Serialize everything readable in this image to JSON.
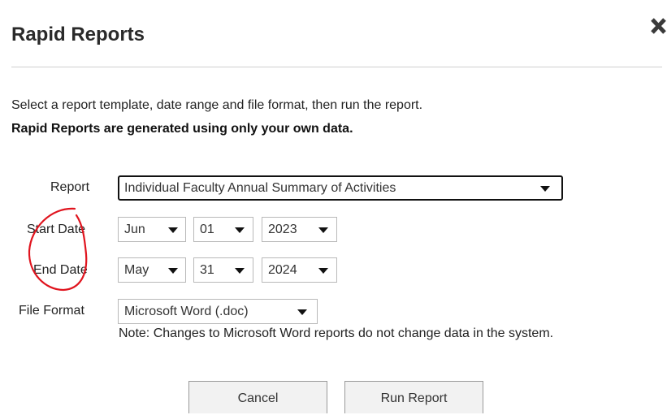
{
  "dialog": {
    "title": "Rapid Reports",
    "close_icon": "close-icon"
  },
  "intro": {
    "text": "Select a report template, date range and file format, then run the report.",
    "bold_text": "Rapid Reports are generated using only your own data."
  },
  "form": {
    "report": {
      "label": "Report",
      "value": "Individual Faculty Annual Summary of Activities"
    },
    "start_date": {
      "label": "Start Date",
      "month": "Jun",
      "day": "01",
      "year": "2023"
    },
    "end_date": {
      "label": "End Date",
      "month": "May",
      "day": "31",
      "year": "2024"
    },
    "file_format": {
      "label": "File Format",
      "value": "Microsoft Word (.doc)",
      "note": "Note: Changes to Microsoft Word reports do not change data in the system."
    }
  },
  "buttons": {
    "cancel_label": "Cancel",
    "run_label": "Run Report"
  },
  "colors": {
    "annotation": "#e0141e",
    "divider": "#cfcfcf",
    "button_bg": "#f2f2f2"
  }
}
